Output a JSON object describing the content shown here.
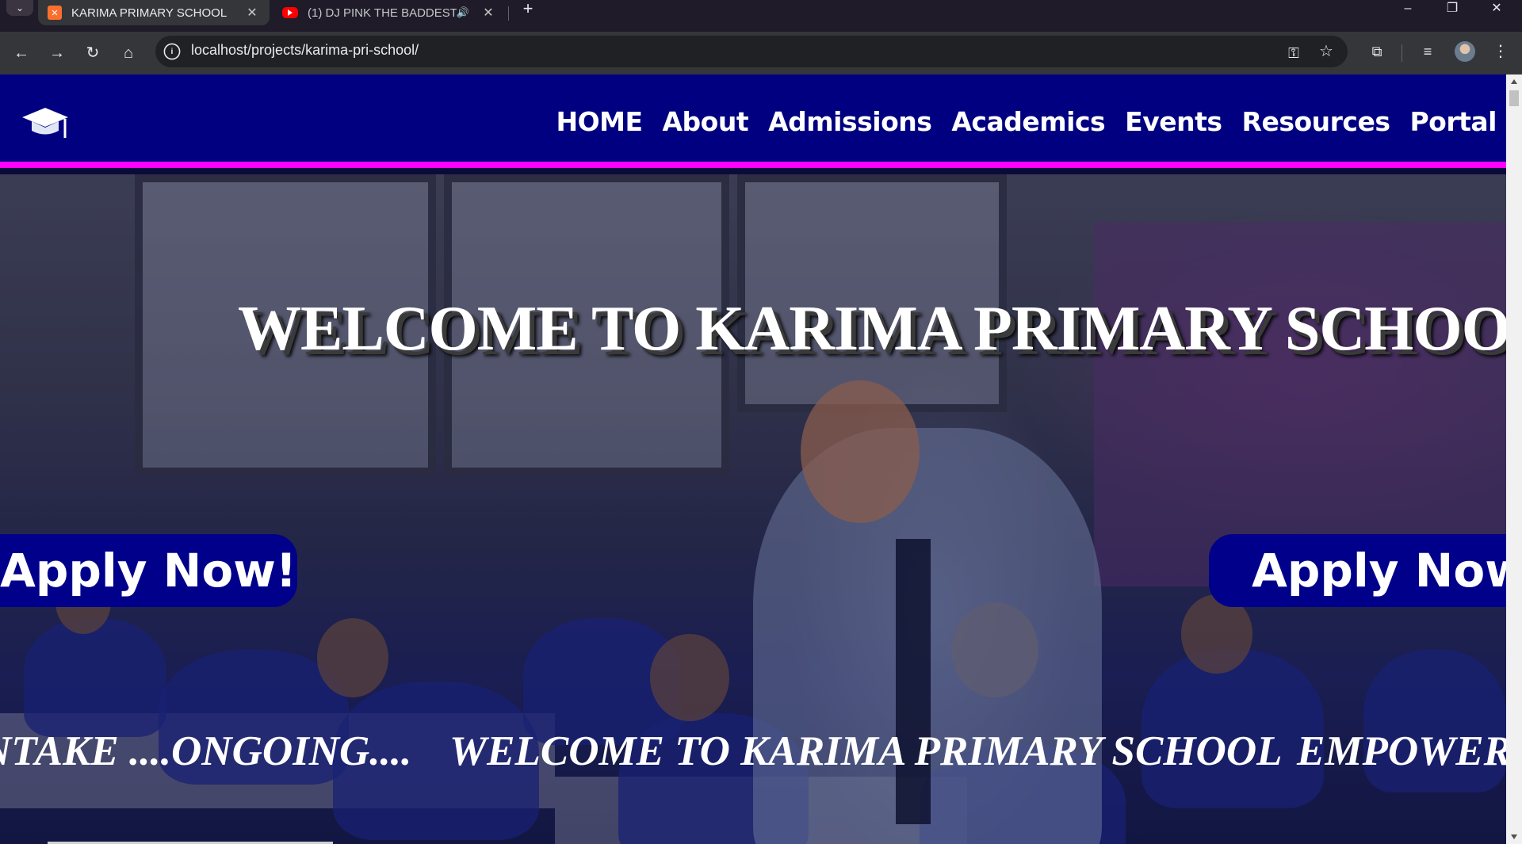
{
  "browser": {
    "tabs": [
      {
        "title": "KARIMA PRIMARY SCHOOL",
        "active": true,
        "favicon": "xampp-icon"
      },
      {
        "title": "(1) DJ PINK THE BADDEST -",
        "active": false,
        "favicon": "youtube-icon",
        "audio": true
      }
    ],
    "url": "localhost/projects/karima-pri-school/"
  },
  "site": {
    "logo": "graduation-cap-icon",
    "nav": [
      "HOME",
      "About",
      "Admissions",
      "Academics",
      "Events",
      "Resources",
      "Portal"
    ],
    "hero": {
      "heading": "WELCOME TO KARIMA PRIMARY SCHOOL",
      "apply_left": "Apply Now!",
      "apply_right": "Apply Now!",
      "marquee": [
        "NTAKE ....ONGOING....",
        "WELCOME TO KARIMA PRIMARY SCHOOL",
        "EMPOWER"
      ]
    }
  },
  "colors": {
    "navbar": "#000080",
    "navbar_border": "#ff00ff",
    "apply_button": "#00008b",
    "text": "#ffffff"
  }
}
